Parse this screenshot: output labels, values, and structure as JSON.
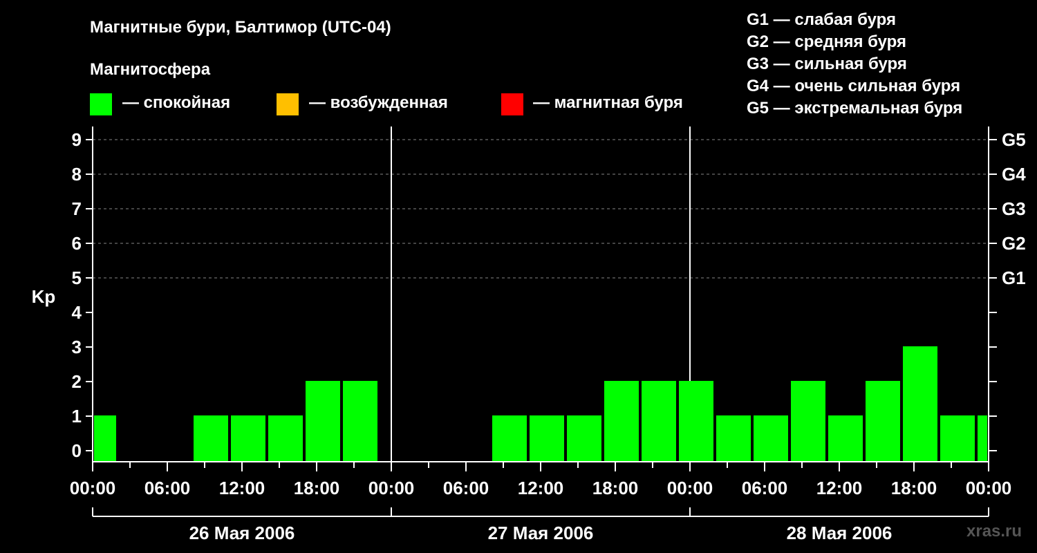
{
  "title": "Магнитные бури, Балтимор (UTC-04)",
  "legend": {
    "heading": "Магнитосфера",
    "items": [
      {
        "label": "— спокойная",
        "color": "#00ff00"
      },
      {
        "label": "— возбужденная",
        "color": "#ffbf00"
      },
      {
        "label": "— магнитная буря",
        "color": "#ff0000"
      }
    ]
  },
  "g_legend": [
    "G1 — слабая буря",
    "G2 — средняя буря",
    "G3 — сильная буря",
    "G4 — очень сильная буря",
    "G5 — экстремальная буря"
  ],
  "watermark": "xras.ru",
  "chart_data": {
    "type": "bar",
    "ylabel": "Kp",
    "ylim": [
      0,
      9
    ],
    "y_ticks": [
      "0",
      "1",
      "2",
      "3",
      "4",
      "5",
      "6",
      "7",
      "8",
      "9"
    ],
    "g_ticks": [
      {
        "kp": 5,
        "label": "G1"
      },
      {
        "kp": 6,
        "label": "G2"
      },
      {
        "kp": 7,
        "label": "G3"
      },
      {
        "kp": 8,
        "label": "G4"
      },
      {
        "kp": 9,
        "label": "G5"
      }
    ],
    "x_tick_labels": [
      "00:00",
      "06:00",
      "12:00",
      "18:00",
      "00:00",
      "06:00",
      "12:00",
      "18:00",
      "00:00",
      "06:00",
      "12:00",
      "18:00",
      "00:00"
    ],
    "days": [
      "26 Мая 2006",
      "27 Мая 2006",
      "28 Мая 2006"
    ],
    "grid": true,
    "bars": [
      {
        "start_h": 0,
        "end_h": 2,
        "kp": 1
      },
      {
        "start_h": 8,
        "end_h": 11,
        "kp": 1
      },
      {
        "start_h": 11,
        "end_h": 14,
        "kp": 1
      },
      {
        "start_h": 14,
        "end_h": 17,
        "kp": 1
      },
      {
        "start_h": 17,
        "end_h": 20,
        "kp": 2
      },
      {
        "start_h": 20,
        "end_h": 23,
        "kp": 2
      },
      {
        "start_h": 32,
        "end_h": 35,
        "kp": 1
      },
      {
        "start_h": 35,
        "end_h": 38,
        "kp": 1
      },
      {
        "start_h": 38,
        "end_h": 41,
        "kp": 1
      },
      {
        "start_h": 41,
        "end_h": 44,
        "kp": 2
      },
      {
        "start_h": 44,
        "end_h": 47,
        "kp": 2
      },
      {
        "start_h": 47,
        "end_h": 50,
        "kp": 2
      },
      {
        "start_h": 50,
        "end_h": 53,
        "kp": 1
      },
      {
        "start_h": 53,
        "end_h": 56,
        "kp": 1
      },
      {
        "start_h": 56,
        "end_h": 59,
        "kp": 2
      },
      {
        "start_h": 59,
        "end_h": 62,
        "kp": 1
      },
      {
        "start_h": 62,
        "end_h": 65,
        "kp": 2
      },
      {
        "start_h": 65,
        "end_h": 68,
        "kp": 3
      },
      {
        "start_h": 68,
        "end_h": 71,
        "kp": 1
      },
      {
        "start_h": 71,
        "end_h": 72,
        "kp": 1
      }
    ]
  }
}
